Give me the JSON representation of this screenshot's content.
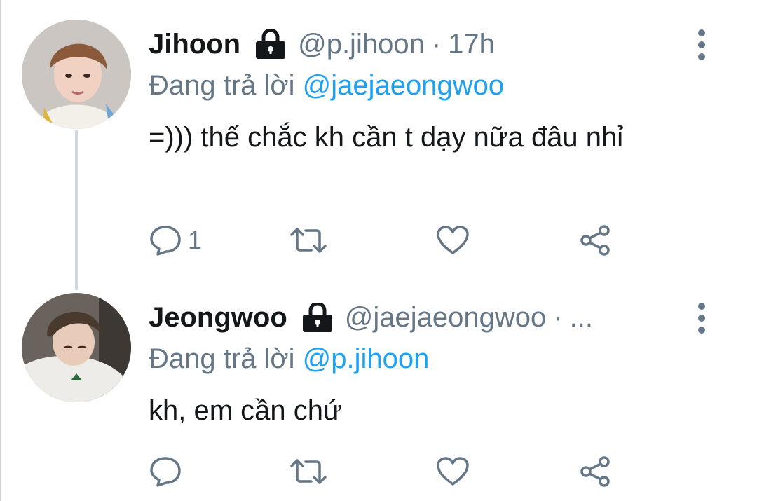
{
  "icons": [
    "lock-icon",
    "more-vertical-icon",
    "reply-icon",
    "retweet-icon",
    "like-icon",
    "share-icon"
  ],
  "colors": {
    "text": "#14171a",
    "muted": "#657786",
    "link": "#1da1f2",
    "thread_line": "#cfd9de"
  },
  "tweets": [
    {
      "name": "Jihoon",
      "handle": "@p.jihoon",
      "separator": "·",
      "time": "17h",
      "reply_prefix": "Đang trả lời",
      "reply_mention": "@jaejaeongwoo",
      "text": "=))) thế chắc kh cần t dạy nữa đâu nhỉ",
      "reply_count": "1"
    },
    {
      "name": "Jeongwoo",
      "handle": "@jaejaeongwoo",
      "separator": "·",
      "time": "...",
      "reply_prefix": "Đang trả lời",
      "reply_mention": "@p.jihoon",
      "text": "kh, em cần chứ",
      "reply_count": ""
    }
  ]
}
